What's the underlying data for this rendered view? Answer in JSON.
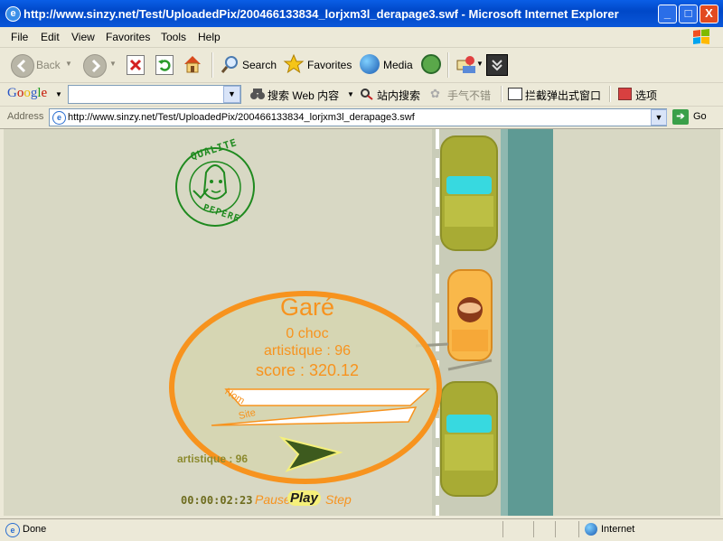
{
  "window": {
    "title": "http://www.sinzy.net/Test/UploadedPix/200466133834_lorjxm3l_derapage3.swf - Microsoft Internet Explorer",
    "controls": [
      "_",
      "□",
      "X"
    ]
  },
  "menu": {
    "items": [
      {
        "label": "File",
        "access": "F"
      },
      {
        "label": "Edit",
        "access": "E"
      },
      {
        "label": "View",
        "access": "V"
      },
      {
        "label": "Favorites",
        "access": "a"
      },
      {
        "label": "Tools",
        "access": "T"
      },
      {
        "label": "Help",
        "access": "H"
      }
    ]
  },
  "toolbar": {
    "back_label": "Back",
    "search_label": "Search",
    "favorites_label": "Favorites",
    "media_label": "Media"
  },
  "googlebar": {
    "brand": "Google",
    "search_web": "搜索 Web 内容",
    "site_search": "站内搜索",
    "lucky": "手气不错",
    "popup_block": "拦截弹出式窗口",
    "options": "选项"
  },
  "address": {
    "label": "Address",
    "url": "http://www.sinzy.net/Test/UploadedPix/200466133834_lorjxm3l_derapage3.swf",
    "go_label": "Go"
  },
  "game": {
    "stamp_top": "QUALITE",
    "stamp_bottom": "PEPERE",
    "result_title": "Garé",
    "shocks": "0 choc",
    "artistic": "artistique : 96",
    "score": "score : 320.12",
    "name_label": "Nom",
    "site_label": "Site",
    "status_artistic": "artistique : 96",
    "timer": "00:00:02:23",
    "pause_label": "Pause",
    "play_label": "Play",
    "step_label": "Step",
    "colors": {
      "orange": "#f7931e",
      "olive_text": "#8c8a2e",
      "grass": "#d8d8c4",
      "road": "#c9ccb8",
      "sea": "#5e9a94",
      "car_green": "#a8ab34",
      "arrow_green": "#3d5a1e",
      "stamp_green": "#1f8a1f"
    }
  },
  "status": {
    "left": "Done",
    "zone": "Internet"
  }
}
